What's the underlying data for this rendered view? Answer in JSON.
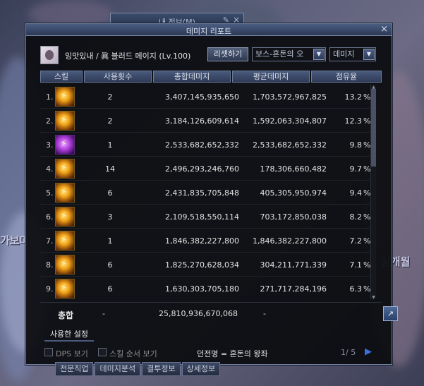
{
  "back_window": {
    "title": "내 정보(M)",
    "pin_icon": "pin-icon",
    "close_icon": "close-icon"
  },
  "window": {
    "title": "데미지 리포트",
    "close_label": "×"
  },
  "header": {
    "character": "잉맛있내 / 眞 블러드 메이지 (Lv.100)",
    "reset_label": "리셋하기",
    "dungeon_select": "보스-혼돈의 오",
    "type_select": "데미지",
    "dropdown_arrow": "▼"
  },
  "columns": {
    "skill": "스킬",
    "count": "사용횟수",
    "total": "총합데미지",
    "avg": "평균데미지",
    "share": "점유율"
  },
  "rows": [
    {
      "rank": "1.",
      "count": "2",
      "total": "3,407,145,935,650",
      "avg": "1,703,572,967,825",
      "share": "13.2",
      "pct": "%"
    },
    {
      "rank": "2.",
      "count": "2",
      "total": "3,184,126,609,614",
      "avg": "1,592,063,304,807",
      "share": "12.3",
      "pct": "%"
    },
    {
      "rank": "3.",
      "count": "1",
      "total": "2,533,682,652,332",
      "avg": "2,533,682,652,332",
      "share": "9.8",
      "pct": "%"
    },
    {
      "rank": "4.",
      "count": "14",
      "total": "2,496,293,246,760",
      "avg": "178,306,660,482",
      "share": "9.7",
      "pct": "%"
    },
    {
      "rank": "5.",
      "count": "6",
      "total": "2,431,835,705,848",
      "avg": "405,305,950,974",
      "share": "9.4",
      "pct": "%"
    },
    {
      "rank": "6.",
      "count": "3",
      "total": "2,109,518,550,114",
      "avg": "703,172,850,038",
      "share": "8.2",
      "pct": "%"
    },
    {
      "rank": "7.",
      "count": "1",
      "total": "1,846,382,227,800",
      "avg": "1,846,382,227,800",
      "share": "7.2",
      "pct": "%"
    },
    {
      "rank": "8.",
      "count": "6",
      "total": "1,825,270,628,034",
      "avg": "304,211,771,339",
      "share": "7.1",
      "pct": "%"
    },
    {
      "rank": "9.",
      "count": "6",
      "total": "1,630,303,705,180",
      "avg": "271,717,284,196",
      "share": "6.3",
      "pct": "%"
    }
  ],
  "total": {
    "label": "총합",
    "count": "-",
    "sum": "25,810,936,670,068",
    "avg": "-"
  },
  "share_icon_glyph": "↗",
  "tab_used_settings": "사용한 설정",
  "footer": {
    "dps_label": "DPS 보기",
    "order_label": "스킬 순서 보기",
    "dungeon": "던전명 = 혼돈의 왕좌",
    "page": "1/ 5",
    "next": "▶"
  },
  "bottom_tabs": [
    "전문직업",
    "데미지분석",
    "결투정보",
    "상세정보"
  ],
  "scene_text": {
    "left": "가보며",
    "right": "심개월"
  }
}
